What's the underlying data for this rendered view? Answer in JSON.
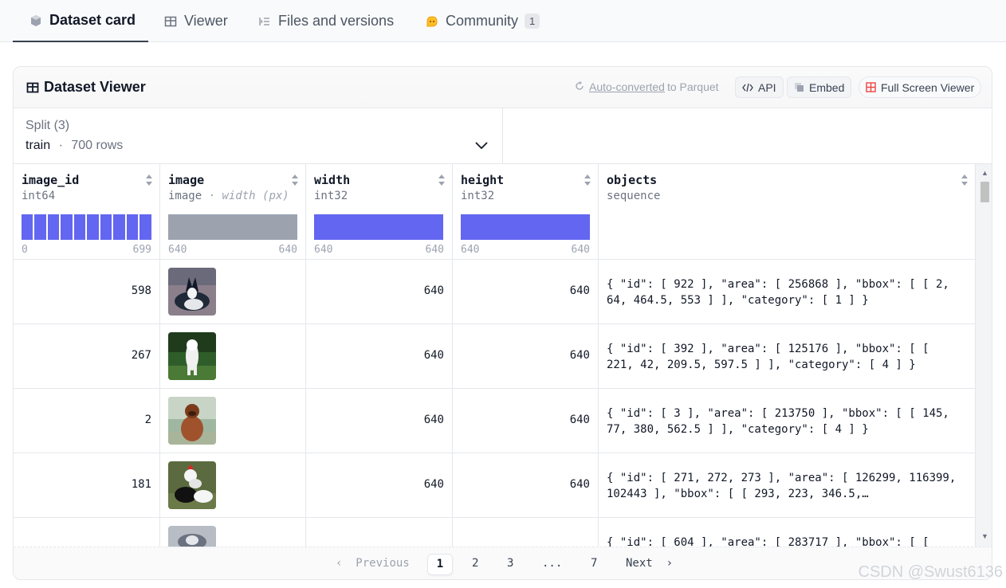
{
  "tabs": [
    {
      "label": "Dataset card",
      "icon": "cube-icon",
      "active": true
    },
    {
      "label": "Viewer",
      "icon": "table-icon",
      "active": false
    },
    {
      "label": "Files and versions",
      "icon": "files-icon",
      "active": false
    },
    {
      "label": "Community",
      "icon": "community-icon",
      "active": false,
      "badge": "1"
    }
  ],
  "viewer": {
    "title": "Dataset Viewer",
    "auto_converted": "Auto-converted",
    "to_parquet": "to Parquet",
    "api_label": "API",
    "embed_label": "Embed",
    "fullscreen_label": "Full Screen Viewer"
  },
  "split": {
    "label": "Split (3)",
    "value": "train",
    "separator": "·",
    "rows": "700 rows"
  },
  "columns": [
    {
      "name": "image_id",
      "type": "int64",
      "min": "0",
      "max": "699"
    },
    {
      "name": "image",
      "type": "image",
      "unit": "· width (px)",
      "min": "640",
      "max": "640"
    },
    {
      "name": "width",
      "type": "int32",
      "min": "640",
      "max": "640"
    },
    {
      "name": "height",
      "type": "int32",
      "min": "640",
      "max": "640"
    },
    {
      "name": "objects",
      "type": "sequence"
    }
  ],
  "rows": [
    {
      "image_id": "598",
      "width": "640",
      "height": "640",
      "objects": "{ \"id\": [ 922 ], \"area\": [ 256868 ], \"bbox\": [ [ 2, 64, 464.5, 553 ] ], \"category\": [ 1 ] }"
    },
    {
      "image_id": "267",
      "width": "640",
      "height": "640",
      "objects": "{ \"id\": [ 392 ], \"area\": [ 125176 ], \"bbox\": [ [ 221, 42, 209.5, 597.5 ] ], \"category\": [ 4 ] }"
    },
    {
      "image_id": "2",
      "width": "640",
      "height": "640",
      "objects": "{ \"id\": [ 3 ], \"area\": [ 213750 ], \"bbox\": [ [ 145, 77, 380, 562.5 ] ], \"category\": [ 4 ] }"
    },
    {
      "image_id": "181",
      "width": "640",
      "height": "640",
      "objects": "{ \"id\": [ 271, 272, 273 ], \"area\": [ 126299, 116399, 102443 ], \"bbox\": [ [ 293, 223, 346.5,…"
    },
    {
      "image_id": "",
      "width": "",
      "height": "",
      "objects": "{ \"id\": [ 604 ], \"area\": [ 283717 ], \"bbox\": [ ["
    }
  ],
  "pagination": {
    "previous": "Previous",
    "pages": [
      "1",
      "2",
      "3",
      "...",
      "7"
    ],
    "current": "1",
    "next": "Next"
  },
  "watermark": "CSDN @Swust6136",
  "colors": {
    "accent": "#6366f1",
    "muted_bar": "#9ca3af",
    "border": "#e5e7eb"
  }
}
